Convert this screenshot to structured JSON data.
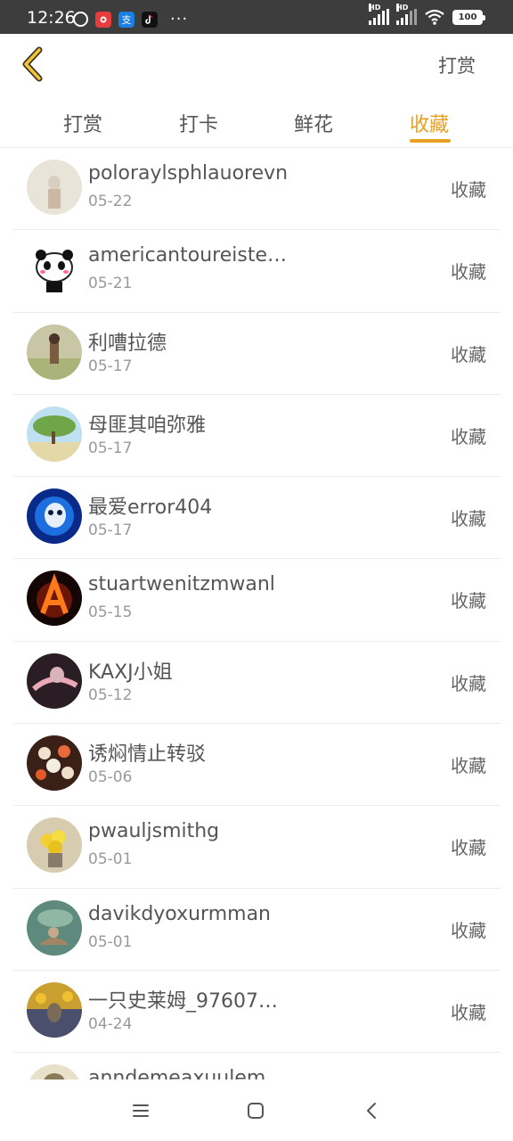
{
  "status_bar": {
    "time": "12:26",
    "dots": "···",
    "hd1": "HD",
    "hd2": "HD",
    "battery": "100",
    "icons": [
      "alarm-icon",
      "red-app-icon",
      "alipay-icon",
      "tiktok-icon"
    ]
  },
  "header": {
    "back_icon": "chevron-left-icon",
    "action_label": "打赏"
  },
  "tabs": [
    {
      "label": "打赏",
      "active": false
    },
    {
      "label": "打卡",
      "active": false
    },
    {
      "label": "鲜花",
      "active": false
    },
    {
      "label": "收藏",
      "active": true
    }
  ],
  "accent_color": "#e8a020",
  "rows": [
    {
      "name": "poloraylsphlauorevn",
      "date": "05-22",
      "action": "收藏"
    },
    {
      "name": "americantoureiste…",
      "date": "05-21",
      "action": "收藏"
    },
    {
      "name": "利嘈拉德",
      "date": "05-17",
      "action": "收藏"
    },
    {
      "name": "母匪其咱弥雅",
      "date": "05-17",
      "action": "收藏"
    },
    {
      "name": "最爱error404",
      "date": "05-17",
      "action": "收藏"
    },
    {
      "name": "stuartwenitzmwanl",
      "date": "05-15",
      "action": "收藏"
    },
    {
      "name": "KAXJ小姐",
      "date": "05-12",
      "action": "收藏"
    },
    {
      "name": "诱焖情止转驳",
      "date": "05-06",
      "action": "收藏"
    },
    {
      "name": "pwauljsmithg",
      "date": "05-01",
      "action": "收藏"
    },
    {
      "name": "davikdyoxurmman",
      "date": "05-01",
      "action": "收藏"
    },
    {
      "name": "一只史莱姆_97607…",
      "date": "04-24",
      "action": "收藏"
    },
    {
      "name": "anndemeaxuulem",
      "date": "",
      "action": ""
    }
  ],
  "nav_bar": {
    "icons": [
      "menu-icon",
      "home-icon",
      "back-icon"
    ]
  }
}
